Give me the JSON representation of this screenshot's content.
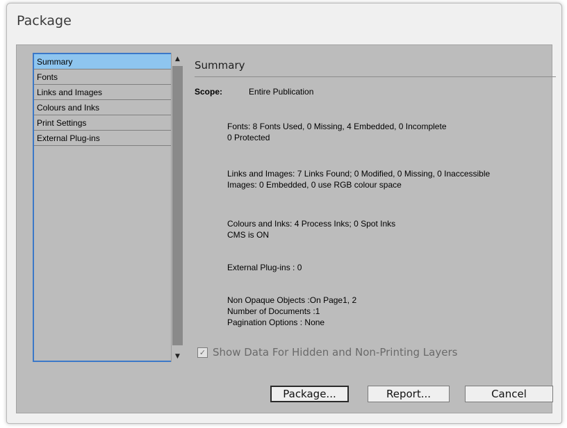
{
  "window": {
    "title": "Package"
  },
  "sidebar": {
    "items": [
      {
        "label": "Summary",
        "selected": true
      },
      {
        "label": "Fonts"
      },
      {
        "label": "Links and Images"
      },
      {
        "label": "Colours and Inks"
      },
      {
        "label": "Print Settings"
      },
      {
        "label": "External Plug-ins"
      }
    ]
  },
  "summary": {
    "title": "Summary",
    "scope_label": "Scope:",
    "scope_value": "Entire Publication",
    "fonts_line1": "Fonts: 8 Fonts Used, 0 Missing, 4 Embedded, 0 Incomplete",
    "fonts_line2": "0 Protected",
    "links_line1": "Links and Images: 7 Links Found; 0 Modified, 0 Missing, 0 Inaccessible",
    "links_line2": "Images: 0 Embedded, 0 use RGB colour space",
    "colours_line1": "Colours and Inks: 4 Process Inks; 0 Spot Inks",
    "colours_line2": "CMS is ON",
    "plugins_line": "External Plug-ins : 0",
    "misc_line1": "Non Opaque Objects :On Page1, 2",
    "misc_line2": "Number of Documents :1",
    "misc_line3": "Pagination Options : None",
    "checkbox_label": "Show Data For Hidden and Non-Printing Layers",
    "checkbox_checked": true
  },
  "buttons": {
    "package": "Package...",
    "report": "Report...",
    "cancel": "Cancel"
  },
  "icons": {
    "check": "✓",
    "scroll_up": "▲",
    "scroll_down": "▼"
  },
  "colors": {
    "selection": "#8ec5ef",
    "list_border": "#3b78c8",
    "panel_bg": "#bcbcbc"
  }
}
